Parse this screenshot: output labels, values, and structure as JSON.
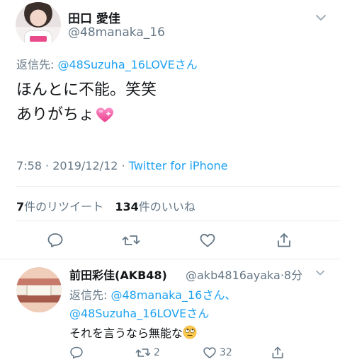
{
  "tweet": {
    "author_name": "田口 愛佳",
    "author_handle": "@48manaka_16",
    "reply_to_label": "返信先: ",
    "reply_to_mention": "@48Suzuha_16LOVEさん",
    "text_line1": "ほんとに不能。笑笑",
    "text_line2": "ありがちょ",
    "emoji": "pink-heart-icon",
    "time": "7:58",
    "date": "2019/12/12",
    "app": "Twitter for iPhone",
    "retweet_count": "7",
    "retweet_label": "件のリツイート",
    "like_count": "134",
    "like_label": "件のいいね",
    "actions": [
      "reply-icon",
      "retweet-icon",
      "like-icon",
      "share-icon"
    ]
  },
  "reply": {
    "author_name": "前田彩佳(AKB48)",
    "author_handle": "@akb4816ayaka",
    "time_ago": "8分",
    "reply_to_label": "返信先: ",
    "reply_to_mention1": "@48manaka_16さん、",
    "reply_to_mention2": "@48Suzuha_16LOVEさん",
    "text": "それを言うなら無能な",
    "emoji": "rolling-eyes-icon",
    "retweet_count": "2",
    "like_count": "32"
  },
  "colors": {
    "accent": "#1da1f2",
    "secondary_text": "#657786",
    "primary_text": "#14171a",
    "divider": "#e6ecf0"
  }
}
